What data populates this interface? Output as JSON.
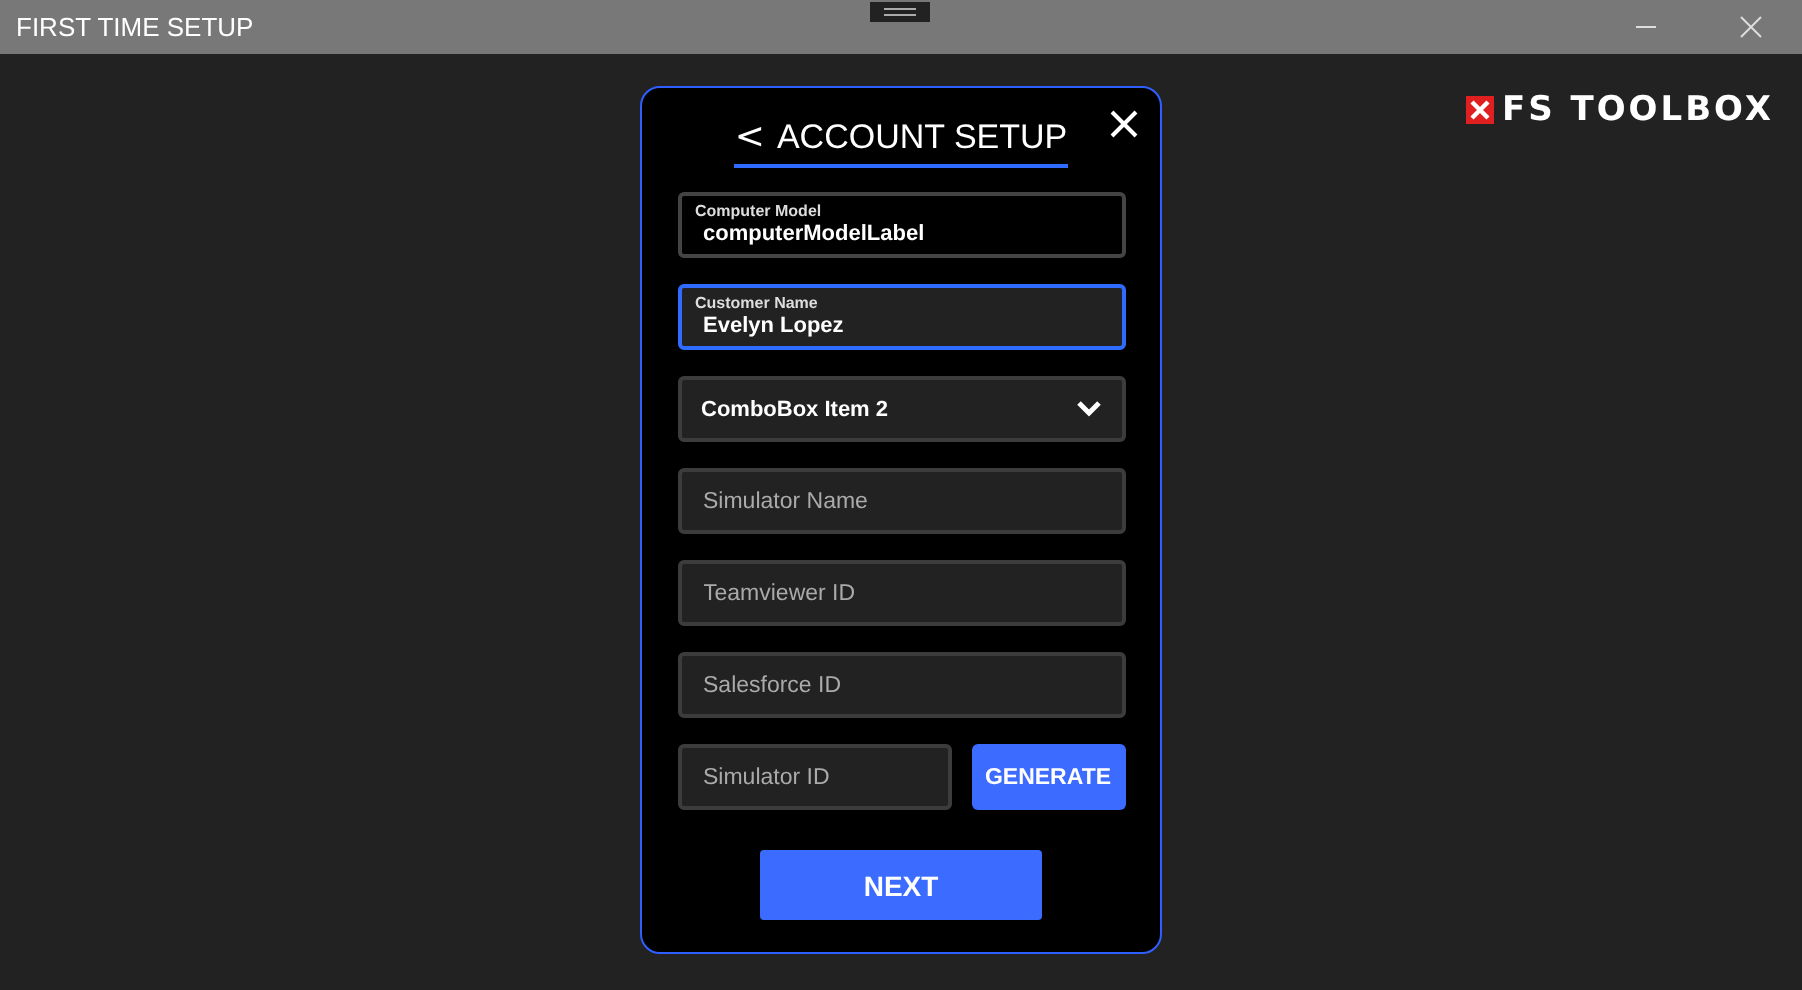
{
  "window": {
    "title": "FIRST TIME SETUP"
  },
  "logo": {
    "text": "FS TOOLBOX"
  },
  "dialog": {
    "back": "<",
    "title": "ACCOUNT SETUP",
    "fields": [
      {
        "kind": "labeled",
        "label": "Computer Model",
        "value": "computerModelLabel",
        "focused": false
      },
      {
        "kind": "labeled",
        "label": "Customer Name",
        "value": "Evelyn Lopez",
        "focused": true
      },
      {
        "kind": "dropdown",
        "value": "ComboBox Item 2",
        "focused": false
      },
      {
        "kind": "text",
        "placeholder": "Simulator Name",
        "focused": false
      },
      {
        "kind": "text",
        "placeholder": "Teamviewer ID",
        "focused": false
      },
      {
        "kind": "text",
        "placeholder": "Salesforce ID",
        "focused": false
      }
    ],
    "id_field": {
      "placeholder": "Simulator ID"
    },
    "generate": "GENERATE",
    "next": "NEXT"
  }
}
